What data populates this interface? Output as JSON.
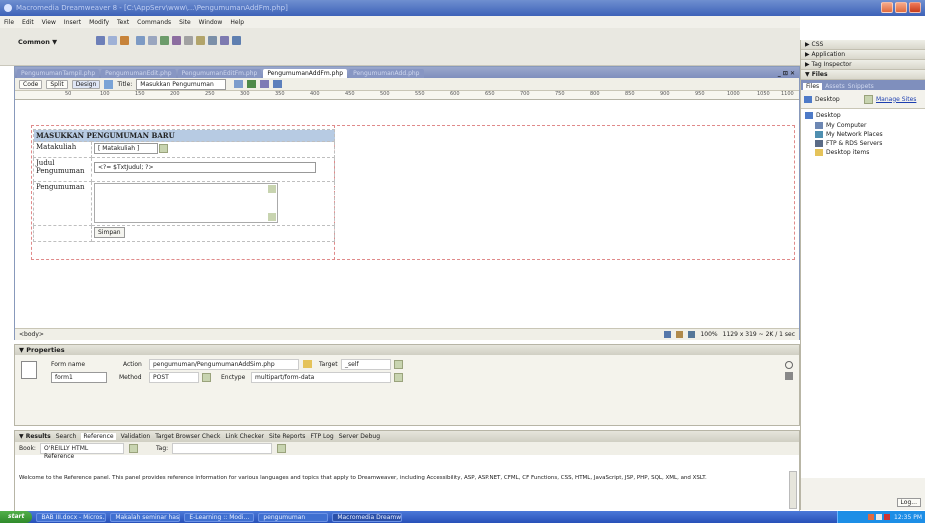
{
  "window": {
    "title": "Macromedia Dreamweaver 8 - [C:\\AppServ\\www\\...\\PengumumanAddFm.php]"
  },
  "menu": [
    "File",
    "Edit",
    "View",
    "Insert",
    "Modify",
    "Text",
    "Commands",
    "Site",
    "Window",
    "Help"
  ],
  "insert_bar": {
    "category": "Common"
  },
  "tabs": [
    "PengumumanTampil.php",
    "PengumumanEdit.php",
    "PengumumanEditFm.php",
    "PengumumanAddFm.php",
    "PengumumanAdd.php"
  ],
  "active_tab_index": 3,
  "doc_toolbar": {
    "code": "Code",
    "split": "Split",
    "design": "Design",
    "title_label": "Title:",
    "title_value": "Masukkan Pengumuman"
  },
  "doc_window_controls": "_ ⊡ ✕",
  "ruler_ticks": [
    "50",
    "100",
    "150",
    "200",
    "250",
    "300",
    "350",
    "400",
    "450",
    "500",
    "550",
    "600",
    "650",
    "700",
    "750",
    "800",
    "850",
    "900",
    "950",
    "1000",
    "1050",
    "1100"
  ],
  "form": {
    "heading": "MASUKKAN PENGUMUMAN BARU",
    "labels": {
      "matakuliah": "Matakuliah",
      "judul": "Judul Pengumuman",
      "pengumuman": "Pengumuman"
    },
    "matakuliah_value": "[ Matakuliah ]",
    "judul_value": "<?= $TxtJudul; ?>",
    "submit_label": "Simpan"
  },
  "status_bar": {
    "tag": "<body>",
    "zoom": "100%",
    "size": "1129 x 319 ~ 2K / 1 sec"
  },
  "properties": {
    "title": "▼ Properties",
    "form_name_label": "Form name",
    "form_name_value": "form1",
    "action_label": "Action",
    "action_value": "pengumuman/PengumumanAddSim.php",
    "method_label": "Method",
    "method_value": "POST",
    "target_label": "Target",
    "target_value": "_self",
    "enctype_label": "Enctype",
    "enctype_value": "multipart/form-data"
  },
  "results": {
    "tabs": [
      "▼ Results",
      "Search",
      "Reference",
      "Validation",
      "Target Browser Check",
      "Link Checker",
      "Site Reports",
      "FTP Log",
      "Server Debug"
    ],
    "book_label": "Book:",
    "book_value": "O'REILLY HTML Reference",
    "tag_label": "Tag:",
    "welcome_text": "Welcome to the Reference panel. This panel provides reference information for various languages and topics that apply to Dreamweaver, including Accessibility, ASP, ASP.NET, CFML, CF Functions, CSS, HTML, JavaScript, JSP, PHP, SQL, XML, and XSLT."
  },
  "right_panel": {
    "groups": [
      "▶ CSS",
      "▶ Application",
      "▶ Tag Inspector",
      "▼ Files"
    ],
    "files_tabs": [
      "Files",
      "Assets",
      "Snippets"
    ],
    "site_select": "Desktop",
    "manage_sites": "Manage Sites",
    "tree": [
      "Desktop",
      "My Computer",
      "My Network Places",
      "FTP & RDS Servers",
      "Desktop items"
    ],
    "log_button": "Log..."
  },
  "taskbar": {
    "start": "start",
    "tasks": [
      "BAB III.docx - Micros...",
      "Makalah seminar hasil...",
      "E-Learning :: Modi...",
      "pengumuman",
      "Macromedia Dreamw..."
    ],
    "time": "12:35 PM"
  }
}
